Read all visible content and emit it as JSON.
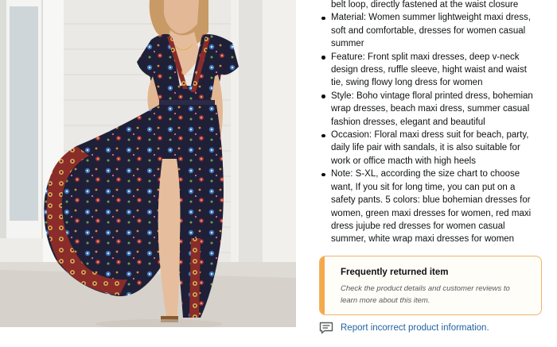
{
  "product_image": {
    "alt": "Woman wearing navy floral boho wrap maxi dress with front split"
  },
  "bullets": [
    {
      "lines": [
        "belt loop, directly fastened at the waist closure"
      ],
      "continuation": true
    },
    {
      "lines": [
        "Material: Women summer lightweight maxi dress,",
        "soft and comfortable, dresses for women casual",
        "summer"
      ]
    },
    {
      "lines": [
        "Feature: Front split maxi dresses, deep v-neck",
        "design dress, ruffle sleeve, hight waist and waist",
        "tie, swing flowy long dress for women"
      ]
    },
    {
      "lines": [
        "Style: Boho vintage floral printed dress, bohemian",
        "wrap dresses, beach maxi dress, summer casual",
        "fashion dresses, elegant and beautiful"
      ]
    },
    {
      "lines": [
        "Occasion: Floral maxi dress suit for beach, party,",
        "daily life pair with sandals, it is also suitable for",
        "work or office macth with high heels"
      ]
    },
    {
      "lines": [
        "Note: S-XL, according the size chart to choose",
        "want, If you sit for long time, you can put on a",
        "safety pants. 5 colors: blue bohemian dresses for",
        "women, green maxi dresses for women, red maxi",
        "dress jujube red dresses for women casual",
        "summer, white wrap maxi dresses for women"
      ]
    }
  ],
  "returned_card": {
    "title": "Frequently returned item",
    "body_line1": "Check the product details and customer reviews to",
    "body_line2": "learn more about this item.",
    "accent_color": "#f4a94a",
    "border_color": "#f0b36b"
  },
  "report": {
    "icon": "feedback-icon",
    "link_text": "Report incorrect product information.",
    "link_color": "#2162a1"
  }
}
